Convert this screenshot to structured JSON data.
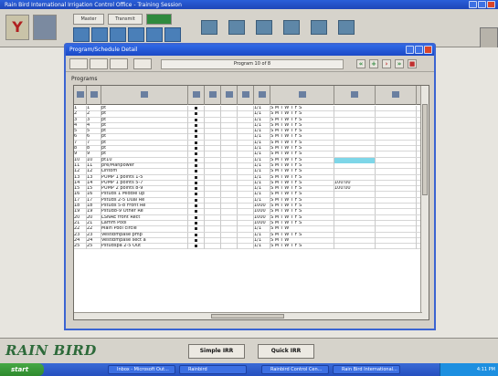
{
  "app": {
    "outer_title": "Rain Bird International Irrigation Control Office - Training Session",
    "toolbar_small": [
      "Master",
      "Transmit"
    ],
    "window_title": "Program/Schedule Detail",
    "program_field": "Program 10 of 8"
  },
  "main": {
    "section_label": "Programs"
  },
  "grid": {
    "rows": [
      {
        "n": "1",
        "id": "1",
        "name": "pt",
        "dot": true,
        "dur": "1/1",
        "days": "S M T W T F S",
        "cyan": false,
        "val": ""
      },
      {
        "n": "2",
        "id": "2",
        "name": "pt",
        "dot": true,
        "dur": "1/1",
        "days": "S M T W T F S",
        "cyan": false,
        "val": ""
      },
      {
        "n": "3",
        "id": "3",
        "name": "pt",
        "dot": true,
        "dur": "1/1",
        "days": "S M T W T F S",
        "cyan": false,
        "val": ""
      },
      {
        "n": "4",
        "id": "4",
        "name": "pt",
        "dot": true,
        "dur": "1/1",
        "days": "S M T W T F S",
        "cyan": false,
        "val": ""
      },
      {
        "n": "5",
        "id": "5",
        "name": "pt",
        "dot": true,
        "dur": "1/1",
        "days": "S M T W T F S",
        "cyan": false,
        "val": ""
      },
      {
        "n": "6",
        "id": "6",
        "name": "pt",
        "dot": true,
        "dur": "1/1",
        "days": "S M T W T F S",
        "cyan": false,
        "val": ""
      },
      {
        "n": "7",
        "id": "7",
        "name": "pt",
        "dot": true,
        "dur": "1/1",
        "days": "S M T W T F S",
        "cyan": false,
        "val": ""
      },
      {
        "n": "8",
        "id": "8",
        "name": "pt",
        "dot": true,
        "dur": "1/1",
        "days": "S M T W T F S",
        "cyan": false,
        "val": ""
      },
      {
        "n": "9",
        "id": "9",
        "name": "pt",
        "dot": true,
        "dur": "1/1",
        "days": "S M T W T F S",
        "cyan": false,
        "val": ""
      },
      {
        "n": "10",
        "id": "10",
        "name": "pt10",
        "dot": true,
        "dur": "1/1",
        "days": "S M T W T F S",
        "cyan": true,
        "val": ""
      },
      {
        "n": "11",
        "id": "11",
        "name": "pre/Manpower",
        "dot": true,
        "dur": "1/1",
        "days": "S M T W T F S",
        "cyan": false,
        "val": ""
      },
      {
        "n": "12",
        "id": "12",
        "name": "Lintom",
        "dot": true,
        "dur": "1/1",
        "days": "S M T W T F S",
        "cyan": false,
        "val": ""
      },
      {
        "n": "13",
        "id": "13",
        "name": "PUMP 1 points 1-5",
        "dot": true,
        "dur": "1/1",
        "days": "S M T W T F S",
        "cyan": false,
        "val": ""
      },
      {
        "n": "14",
        "id": "14",
        "name": "PUMP 1 points 5-7",
        "dot": true,
        "dur": "1/1",
        "days": "S M T W T F S",
        "cyan": false,
        "val": "100:00"
      },
      {
        "n": "15",
        "id": "15",
        "name": "PUMP 2 points 8-9",
        "dot": true,
        "dur": "1/1",
        "days": "S M T W T F S",
        "cyan": false,
        "val": "100:00"
      },
      {
        "n": "16",
        "id": "16",
        "name": "Pstuds 1 Middle up",
        "dot": true,
        "dur": "1/1",
        "days": "S M T W T F S",
        "cyan": false,
        "val": ""
      },
      {
        "n": "17",
        "id": "17",
        "name": "Pstuds 2-5 Dual Re",
        "dot": true,
        "dur": "1/1",
        "days": "S M T W T F S",
        "cyan": false,
        "val": ""
      },
      {
        "n": "18",
        "id": "18",
        "name": "Pstuds 5-8 Front Re",
        "dot": true,
        "dur": "1000",
        "days": "S M T W T F S",
        "cyan": false,
        "val": ""
      },
      {
        "n": "19",
        "id": "19",
        "name": "Pstud8-9 Other Re",
        "dot": true,
        "dur": "1000",
        "days": "S M T W T F S",
        "cyan": false,
        "val": ""
      },
      {
        "n": "20",
        "id": "20",
        "name": "LSNAE front Rect",
        "dot": true,
        "dur": "1000",
        "days": "S M T W T F S",
        "cyan": false,
        "val": ""
      },
      {
        "n": "21",
        "id": "21",
        "name": "Lamm Pool",
        "dot": true,
        "dur": "1000",
        "days": "S M T W T F S",
        "cyan": false,
        "val": ""
      },
      {
        "n": "22",
        "id": "22",
        "name": "Main Pool circle",
        "dot": true,
        "dur": "1/1",
        "days": "S   M   T   W",
        "cyan": false,
        "val": ""
      },
      {
        "n": "23",
        "id": "23",
        "name": "Vestibmpase pmp",
        "dot": true,
        "dur": "1/1",
        "days": "S M T W T F S",
        "cyan": false,
        "val": ""
      },
      {
        "n": "24",
        "id": "24",
        "name": "Vestibmpase sect a",
        "dot": true,
        "dur": "1/1",
        "days": "S   M   T   W",
        "cyan": false,
        "val": ""
      },
      {
        "n": "25",
        "id": "25",
        "name": "Pstudspa 2-5 Out",
        "dot": true,
        "dur": "1/1",
        "days": "S M T W T F S",
        "cyan": false,
        "val": ""
      }
    ]
  },
  "bottom": {
    "brand": "RAIN BIRD",
    "btn_simple": "Simple IRR",
    "btn_quick": "Quick IRR"
  },
  "taskbar": {
    "start": "start",
    "tasks": [
      "Inbox - Microsoft Out...",
      "Rainbird",
      "Rainbird Control Cen...",
      "Rain Bird International..."
    ],
    "clock": "4:11 PM"
  },
  "colors": {
    "titlebar": "#2f69e6",
    "highlight": "#7ed6e8",
    "brand": "#2d6a3a"
  }
}
